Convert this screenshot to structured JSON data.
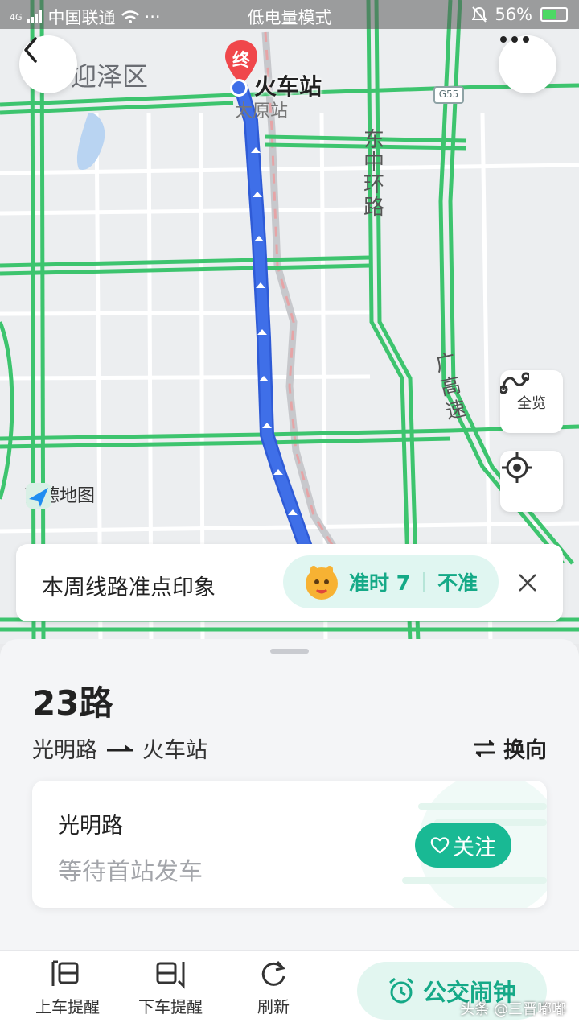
{
  "status_bar": {
    "network": "4G",
    "carrier": "中国联通",
    "more": "···",
    "mode": "低电量模式",
    "battery_percent": "56%",
    "battery_level": 0.56
  },
  "map": {
    "district_label": "迎泽区",
    "destination_marker": "终",
    "destination_name": "火车站",
    "station_label": "太原站",
    "road_east_ring": "东中环路",
    "road_expressway": "广高速",
    "highway_badge": "G55",
    "logo_text": "高德地图",
    "overview_label": "全览"
  },
  "punctuality_banner": {
    "text": "本周线路准点印象",
    "on_time_label": "准时 7",
    "not_on_time_label": "不准"
  },
  "route": {
    "name": "23路",
    "from": "光明路",
    "to": "火车站",
    "reverse_label": "换向"
  },
  "station_card": {
    "station": "光明路",
    "status": "等待首站发车",
    "follow_label": "关注"
  },
  "bottom_bar": {
    "board_reminder": "上车提醒",
    "alight_reminder": "下车提醒",
    "refresh": "刷新",
    "bus_alarm": "公交闹钟"
  },
  "watermark": "头条 @三晋嘟嘟",
  "colors": {
    "route_line": "#3f6fe8",
    "road_green": "#3dc46e",
    "accent": "#19b994",
    "destination_red": "#f0474b"
  }
}
